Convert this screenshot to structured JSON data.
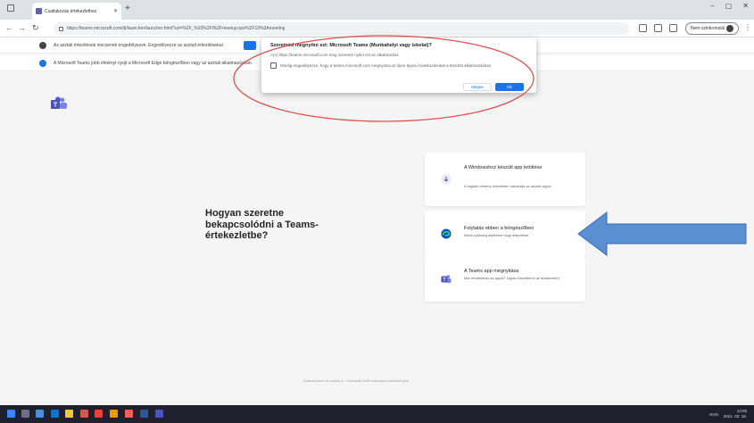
{
  "browser": {
    "tab_title": "Csatlakozás értekezlethez",
    "address": "https://teams.microsoft.com/dl/launcher/launcher.html?url=%2F_%23%2Fl%2Fmeetup-join%2F19%3Ameeting",
    "profile_label": "Nem szinkronizál"
  },
  "notifications": [
    {
      "text": "Az asztali értesítések nincsenek engedélyezve. Engedélyezze az asztali értesítéseket.",
      "color": "#444444"
    },
    {
      "text": "A Microsoft Teams jobb élményt nyújt a Microsoft Edge böngészőben vagy az asztali alkalmazásban.",
      "color": "#1a73e8"
    }
  ],
  "dialog": {
    "title": "Szeretnéd megnyitni ezt: Microsoft Teams (Munkahelyi vagy iskolai)?",
    "subtitle": "A(z) https://teams.microsoft.com meg szeretné nyitni ezt az alkalmazást.",
    "checkbox_label": "Mindig engedélyezze, hogy a teams.microsoft.com megnyissa az ilyen típusú hivatkozásokat a társított alkalmazásban",
    "cancel_label": "Mégse",
    "open_label": "Ok"
  },
  "page": {
    "question": "Hogyan szeretne bekapcsolódni a Teams-értekezletbe?",
    "options": [
      {
        "title": "A Windowshoz készült app letöltése",
        "desc": "A legjobb élmény érdekében használja az asztali appot."
      },
      {
        "title": "Folytatás ebben a böngészőben",
        "desc": "Nincs szükség letöltésre vagy telepítésre."
      },
      {
        "title": "A Teams app megnyitása",
        "desc": "Már rendelkezik az appal? Ugrás közvetlenül az értekezletre."
      }
    ],
    "footer": "Adatvédelem és cookie-k · Harmadik féltől származó közlemények"
  },
  "taskbar": {
    "tray_text": "HUN",
    "time": "13:05",
    "date": "2021. 03. 18."
  },
  "colors": {
    "annotation_red": "#d9534f",
    "arrow_blue": "#5b8fd4",
    "teams_purple": "#6264a7",
    "accent_blue": "#1a73e8"
  }
}
